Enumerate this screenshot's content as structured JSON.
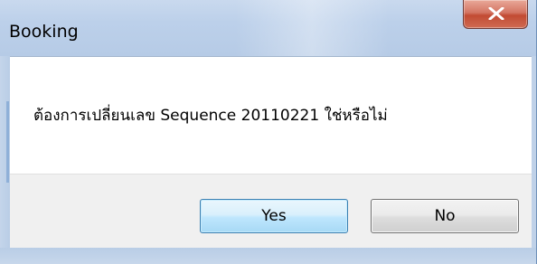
{
  "window": {
    "title": "Booking"
  },
  "message": {
    "text": "ต้องการเปลี่ยนเลข  Sequence  20110221 ใช่หรือไม่"
  },
  "buttons": {
    "yes_label": "Yes",
    "no_label": "No"
  },
  "icons": {
    "close": "close-icon"
  },
  "colors": {
    "titlebar": "#bcd0ea",
    "close_button": "#c24b33",
    "default_button_border": "#3c7fb1",
    "footer": "#f0f0f0"
  }
}
